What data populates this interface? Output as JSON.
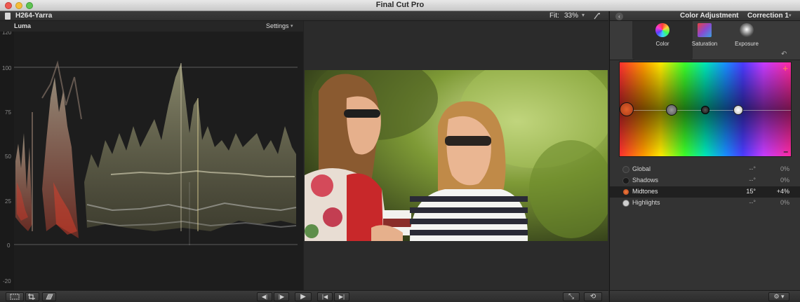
{
  "window": {
    "title": "Final Cut Pro"
  },
  "viewer": {
    "clip_name": "H264-Yarra",
    "fit_label": "Fit:",
    "fit_value": "33%",
    "chevron": "▾",
    "wand_icon": "wand-icon"
  },
  "scope": {
    "title": "Luma",
    "settings_label": "Settings",
    "chevron": "▾",
    "axis_labels": [
      "120",
      "100",
      "75",
      "50",
      "25",
      "0",
      "-20"
    ]
  },
  "toolbar": {
    "left_icons": [
      "transform-icon",
      "crop-icon",
      "distort-icon"
    ],
    "transport_icons": [
      "step-back-icon",
      "step-forward-icon",
      "play-icon",
      "previous-edit-icon",
      "next-edit-icon"
    ],
    "right_icons": [
      "fullscreen-icon",
      "loop-icon"
    ],
    "glyphs": {
      "step_back": "◀︎|",
      "step_forward": "|▶︎",
      "play": "▶",
      "prev": "|◀",
      "next": "▶|",
      "fullscreen": "⤡",
      "loop": "⟲"
    }
  },
  "inspector": {
    "title": "Color Adjustment",
    "correction": "Correction 1",
    "chevron": "▾",
    "back_glyph": "‹",
    "tabs": [
      {
        "label": "Color",
        "icon": "color-wheel-icon",
        "active": true
      },
      {
        "label": "Saturation",
        "icon": "saturation-icon",
        "active": false
      },
      {
        "label": "Exposure",
        "icon": "exposure-icon",
        "active": false
      }
    ],
    "reset_glyph": "↶",
    "board": {
      "plus": "+",
      "minus": "–"
    },
    "rows": [
      {
        "name": "Global",
        "angle": "--°",
        "percent": "0%",
        "dot": "#3a3a3a",
        "selected": false
      },
      {
        "name": "Shadows",
        "angle": "--°",
        "percent": "0%",
        "dot": "#1a1a1a",
        "selected": false
      },
      {
        "name": "Midtones",
        "angle": "15°",
        "percent": "+4%",
        "dot": "#e2602a",
        "selected": true
      },
      {
        "name": "Highlights",
        "angle": "--°",
        "percent": "0%",
        "dot": "#cfcfcf",
        "selected": false
      }
    ],
    "gear_glyph": "⚙ ▾"
  }
}
